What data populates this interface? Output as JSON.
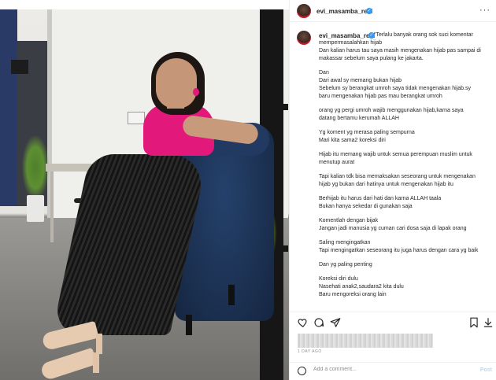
{
  "post": {
    "username": "evi_masamba_real",
    "more_icon": "more-options-icon",
    "caption_lines": [
      "\"Terlalu banyak orang sok suci komentar",
      "mempermasalahkan hijab",
      "Dan kalian harus tau saya masih mengenakan hijab pas sampai di",
      "makassar sebelum saya pulang ke jakarta.",
      "Dan",
      "Dari awal sy memang bukan hijab",
      "Sebelum sy berangkat umroh saya tidak mengenakan hijab.sy",
      "baru mengenakan hijab pas mau berangkat umroh",
      "orang yg pergi umroh wajib menggunakan hijab,karna saya",
      "datang bertamu kerumah ALLAH",
      "Yg koment yg merasa paling sempurna",
      "Mari kita sama2 koreksi diri",
      "Hijab itu memang wajib untuk semua perempuan muslim untuk",
      "menutup aurat",
      "Tapi kalian tdk bisa memaksakan seseorang untuk mengenakan",
      "hijab yg bukan dari hatinya untuk mengenakan hijab itu",
      "Berhijab itu harus dari hati dan karna ALLAH taala",
      "Bukan hanya sekedar di gunakan saja",
      "Komentlah dengan bijak",
      "Jangan jadi manusia yg cuman cari dosa saja di lapak orang",
      "Saling mengingatkan",
      "Tapi mengingatkan seseorang itu juga harus dengan cara yg baik",
      "Dan yg paling penting",
      "Koreksi diri dulu",
      "Nasehati anak2,saudara2 kita dulu",
      "Baru mengoreksi orang lain"
    ],
    "gap_before": [
      4,
      8,
      10,
      12,
      14,
      16,
      18,
      20,
      22,
      23
    ],
    "timestamp": "1 DAY AGO",
    "actions": {
      "like_icon": "heart-icon",
      "comment_icon": "comment-icon",
      "share_icon": "share-icon",
      "save_icon": "bookmark-icon",
      "download_icon": "download-icon"
    },
    "comment": {
      "placeholder": "Add a comment...",
      "post_label": "Post",
      "emoji_icon": "emoji-icon"
    }
  },
  "colors": {
    "verified_badge": "#3897f0",
    "post_button_disabled": "#b3dbff",
    "top_color": "#e2197a"
  }
}
